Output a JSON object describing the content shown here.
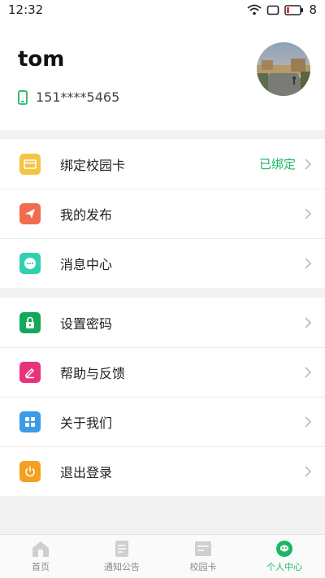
{
  "status_bar": {
    "time": "12:32",
    "battery": "8"
  },
  "profile": {
    "name": "tom",
    "phone": "151****5465"
  },
  "menu_group1": [
    {
      "label": "绑定校园卡",
      "status": "已绑定",
      "color": "#f4c542"
    },
    {
      "label": "我的发布",
      "status": "",
      "color": "#f06b4f"
    },
    {
      "label": "消息中心",
      "status": "",
      "color": "#2fd1b0"
    }
  ],
  "menu_group2": [
    {
      "label": "设置密码",
      "color": "#14a85b"
    },
    {
      "label": "帮助与反馈",
      "color": "#e8327a"
    },
    {
      "label": "关于我们",
      "color": "#3a9be8"
    },
    {
      "label": "退出登录",
      "color": "#f5a020"
    }
  ],
  "tabs": [
    {
      "label": "首页",
      "active": false
    },
    {
      "label": "通知公告",
      "active": false
    },
    {
      "label": "校园卡",
      "active": false
    },
    {
      "label": "个人中心",
      "active": true
    }
  ],
  "colors": {
    "accent": "#1db665"
  }
}
